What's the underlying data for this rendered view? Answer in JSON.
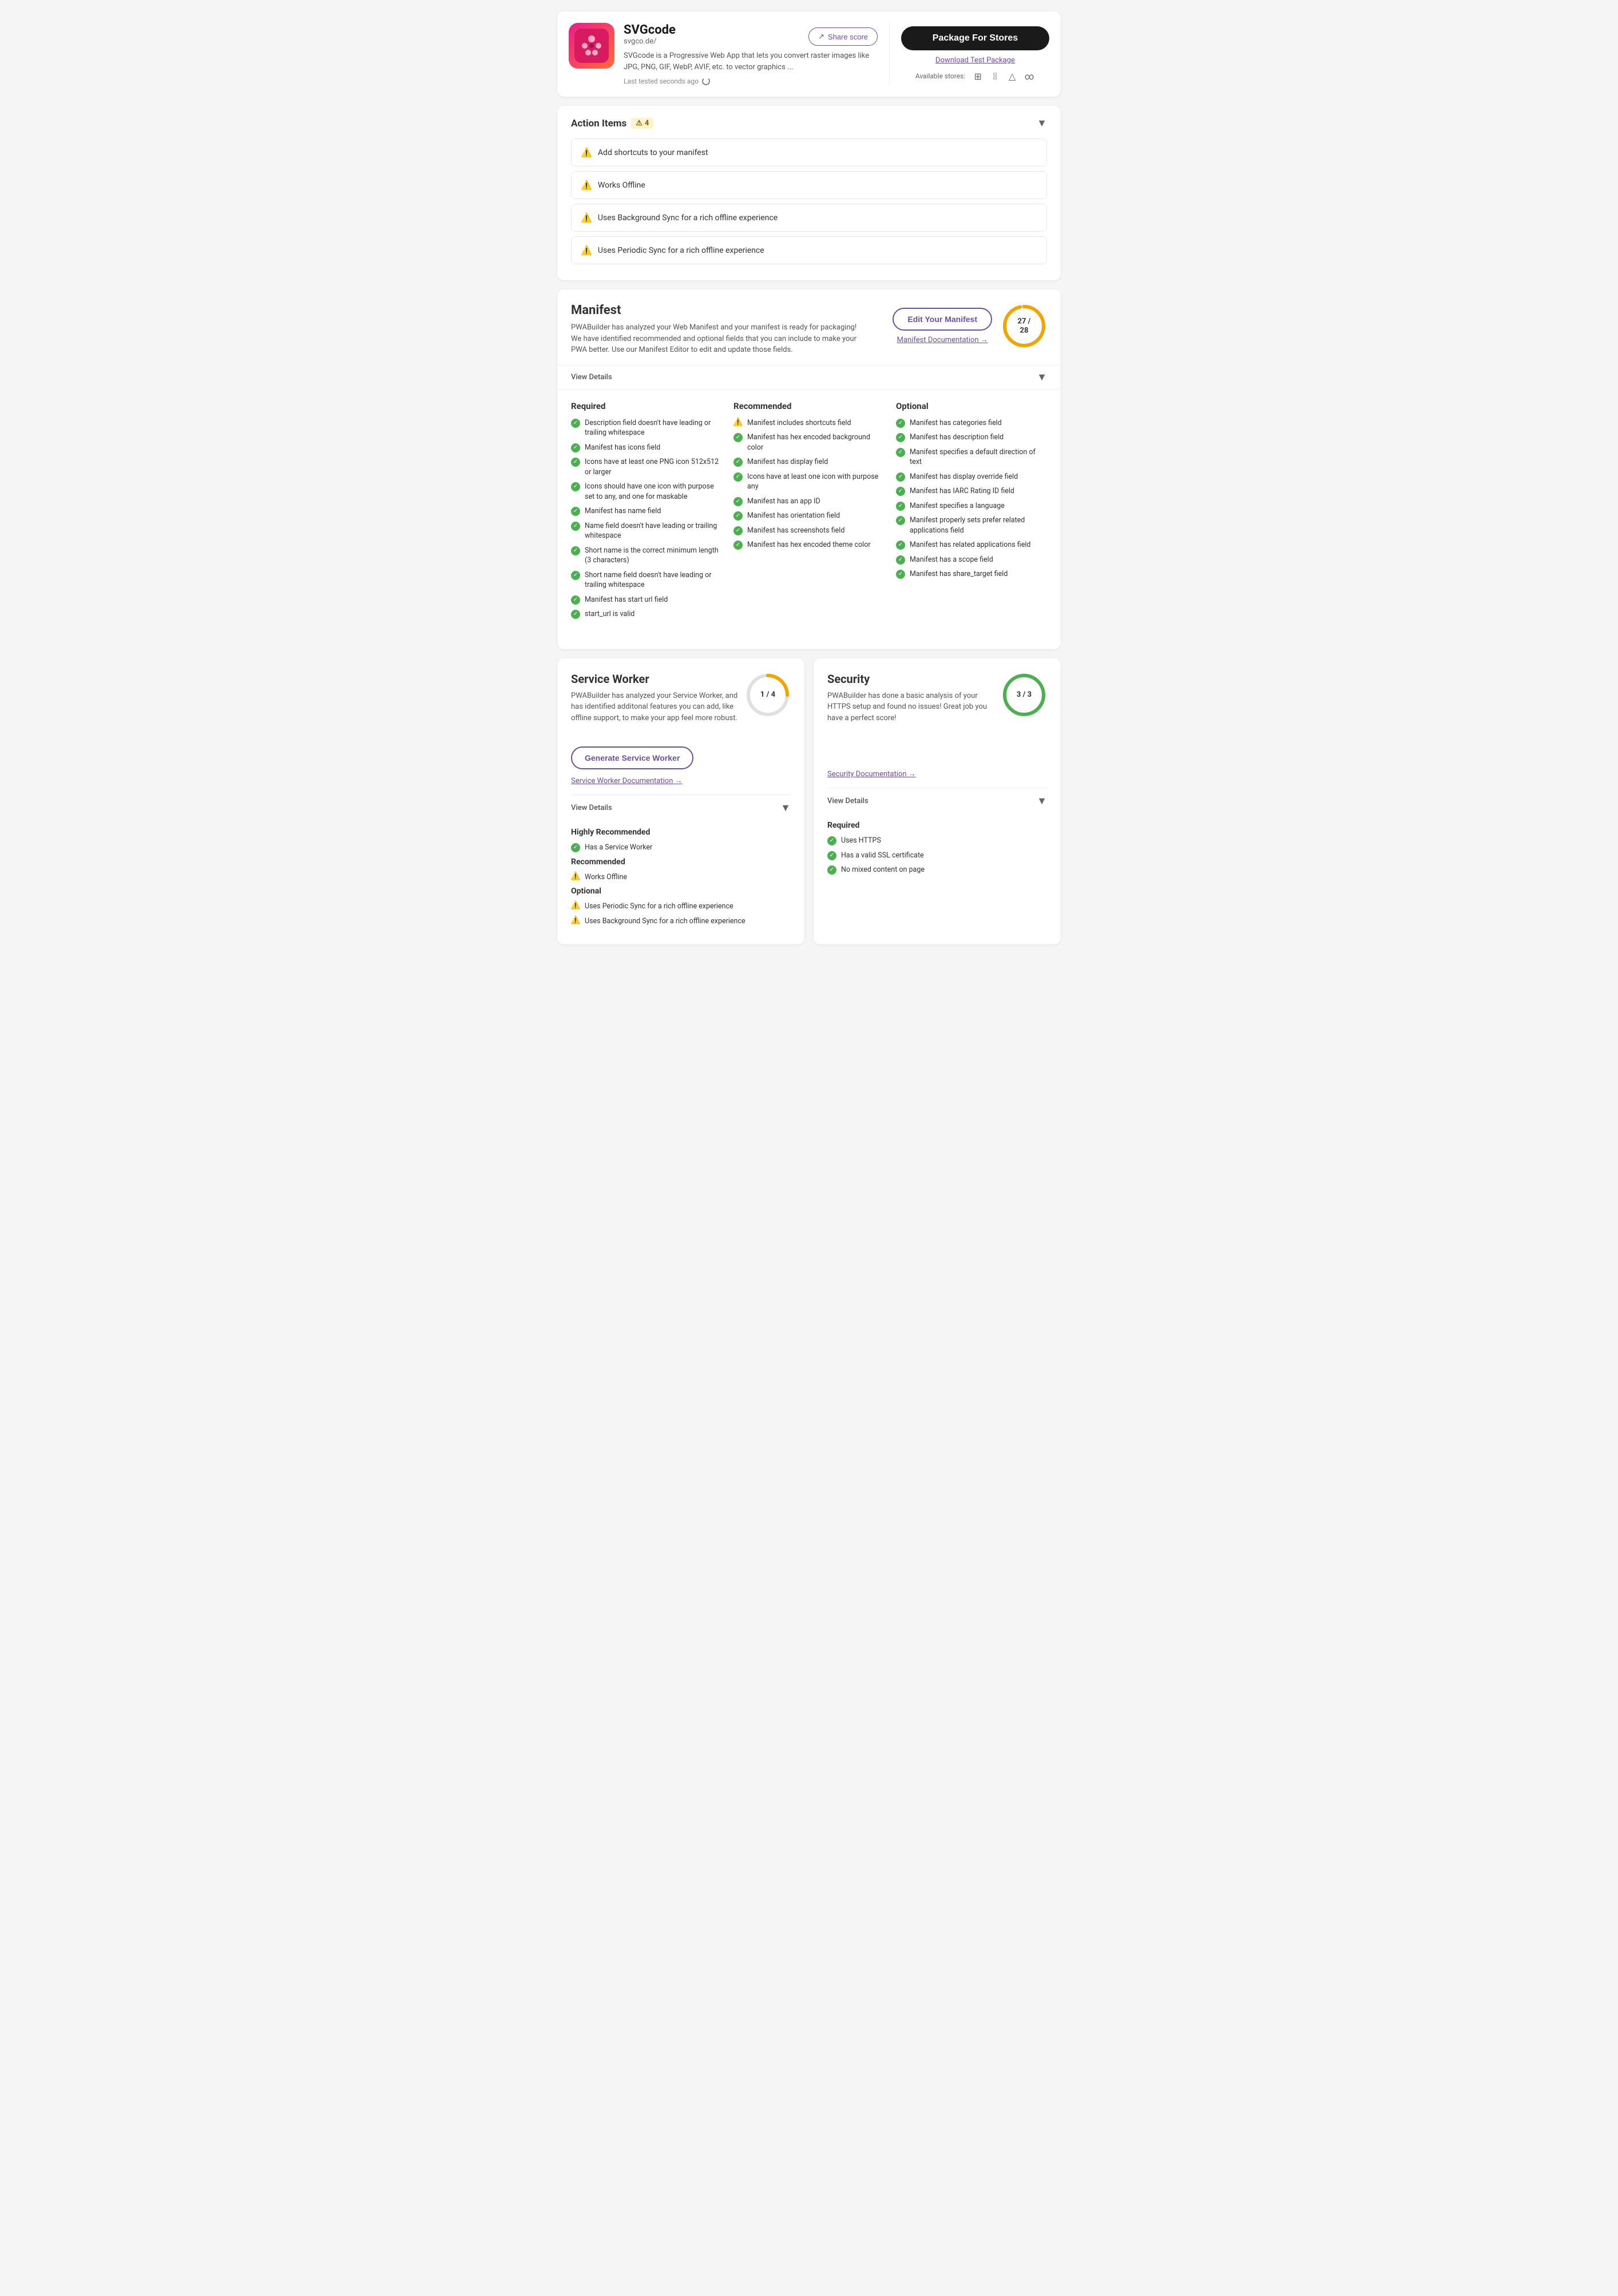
{
  "header": {
    "app_name": "SVGcode",
    "app_url": "svgco.de/",
    "app_desc": "SVGcode is a Progressive Web App that lets you convert raster images like JPG, PNG, GIF, WebP, AVIF, etc. to vector graphics ...",
    "share_label": "Share score",
    "last_tested": "Last tested seconds ago",
    "package_btn": "Package For Stores",
    "download_link": "Download Test Package",
    "available_stores_label": "Available stores:"
  },
  "action_items": {
    "title": "Action Items",
    "count": "4",
    "items": [
      {
        "text": "Add shortcuts to your manifest"
      },
      {
        "text": "Works Offline"
      },
      {
        "text": "Uses Background Sync for a rich offline experience"
      },
      {
        "text": "Uses Periodic Sync for a rich offline experience"
      }
    ]
  },
  "manifest": {
    "title": "Manifest",
    "desc": "PWABuilder has analyzed your Web Manifest and your manifest is ready for packaging! We have identified recommended and optional fields that you can include to make your PWA better. Use our Manifest Editor to edit and update those fields.",
    "edit_btn": "Edit Your Manifest",
    "doc_link": "Manifest Documentation",
    "score_current": "27",
    "score_total": "28",
    "view_details": "View Details",
    "required_title": "Required",
    "recommended_title": "Recommended",
    "optional_title": "Optional",
    "required_items": [
      {
        "text": "Description field doesn't have leading or trailing whitespace",
        "pass": true
      },
      {
        "text": "Manifest has icons field",
        "pass": true
      },
      {
        "text": "Icons have at least one PNG icon 512x512 or larger",
        "pass": true
      },
      {
        "text": "Icons should have one icon with purpose set to any, and one for maskable",
        "pass": true
      },
      {
        "text": "Manifest has name field",
        "pass": true
      },
      {
        "text": "Name field doesn't have leading or trailing whitespace",
        "pass": true
      },
      {
        "text": "Short name is the correct minimum length (3 characters)",
        "pass": true
      },
      {
        "text": "Short name field doesn't have leading or trailing whitespace",
        "pass": true
      },
      {
        "text": "Manifest has start url field",
        "pass": true
      },
      {
        "text": "start_url is valid",
        "pass": true
      }
    ],
    "recommended_items": [
      {
        "text": "Manifest includes shortcuts field",
        "pass": false
      },
      {
        "text": "Manifest has hex encoded background color",
        "pass": true
      },
      {
        "text": "Manifest has display field",
        "pass": true
      },
      {
        "text": "Icons have at least one icon with purpose any",
        "pass": true
      },
      {
        "text": "Manifest has an app ID",
        "pass": true
      },
      {
        "text": "Manifest has orientation field",
        "pass": true
      },
      {
        "text": "Manifest has screenshots field",
        "pass": true
      },
      {
        "text": "Manifest has hex encoded theme color",
        "pass": true
      }
    ],
    "optional_items": [
      {
        "text": "Manifest has categories field",
        "pass": true
      },
      {
        "text": "Manifest has description field",
        "pass": true
      },
      {
        "text": "Manifest specifies a default direction of text",
        "pass": true
      },
      {
        "text": "Manifest has display override field",
        "pass": true
      },
      {
        "text": "Manifest has IARC Rating ID field",
        "pass": true
      },
      {
        "text": "Manifest specifies a language",
        "pass": true
      },
      {
        "text": "Manifest properly sets prefer related applications field",
        "pass": true
      },
      {
        "text": "Manifest has related applications field",
        "pass": true
      },
      {
        "text": "Manifest has a scope field",
        "pass": true
      },
      {
        "text": "Manifest has share_target field",
        "pass": true
      }
    ]
  },
  "service_worker": {
    "title": "Service Worker",
    "desc": "PWABuilder has analyzed your Service Worker, and has identified additonal features you can add, like offline support, to make your app feel more robust.",
    "score_current": "1",
    "score_total": "4",
    "gen_btn": "Generate Service Worker",
    "doc_link": "Service Worker Documentation",
    "view_details": "View Details",
    "highly_recommended_title": "Highly Recommended",
    "recommended_title": "Recommended",
    "optional_title": "Optional",
    "highly_recommended_items": [
      {
        "text": "Has a Service Worker",
        "pass": true
      }
    ],
    "recommended_items": [
      {
        "text": "Works Offline",
        "pass": false
      }
    ],
    "optional_items": [
      {
        "text": "Uses Periodic Sync for a rich offline experience",
        "pass": false
      },
      {
        "text": "Uses Background Sync for a rich offline experience",
        "pass": false
      }
    ]
  },
  "security": {
    "title": "Security",
    "desc": "PWABuilder has done a basic analysis of your HTTPS setup and found no issues! Great job you have a perfect score!",
    "score_current": "3",
    "score_total": "3",
    "doc_link": "Security Documentation",
    "view_details": "View Details",
    "required_title": "Required",
    "required_items": [
      {
        "text": "Uses HTTPS",
        "pass": true
      },
      {
        "text": "Has a valid SSL certificate",
        "pass": true
      },
      {
        "text": "No mixed content on page",
        "pass": true
      }
    ]
  },
  "icons": {
    "share": "↗",
    "chevron_down": "▼",
    "arrow_right": "→",
    "refresh": "↻",
    "check": "✓",
    "warn": "⚠"
  },
  "colors": {
    "purple": "#6b4fa0",
    "green": "#4caf50",
    "warn_yellow": "#f0a500",
    "dark": "#1a1a1a"
  }
}
